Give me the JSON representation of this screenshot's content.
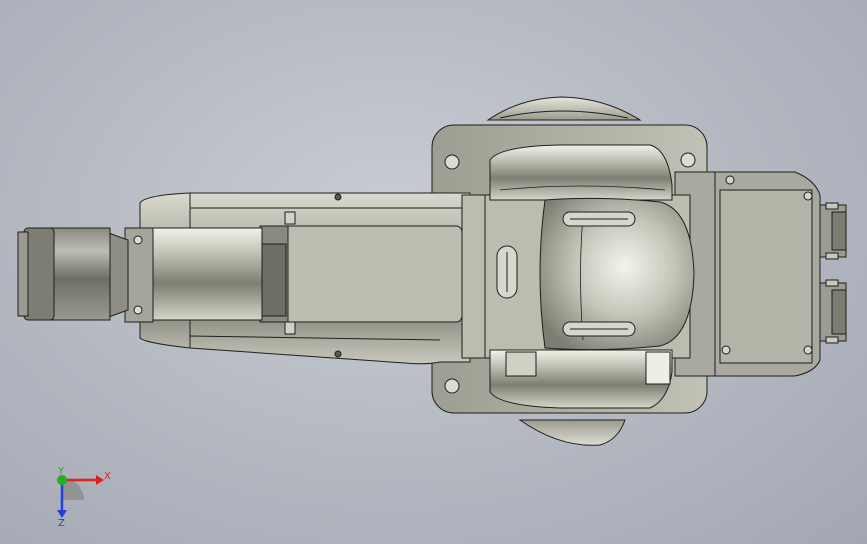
{
  "triad": {
    "x_label": "X",
    "y_label": "Y",
    "z_label": "Z"
  },
  "colors": {
    "background": "#b8bcc5",
    "body_metal": "#b9b9ac",
    "body_shadow": "#6f6f66",
    "edge": "#1e1e1e",
    "axis_x": "#e02020",
    "axis_y": "#20b020",
    "axis_z": "#2040e0"
  },
  "icons": [
    "coordinate-triad-icon"
  ]
}
